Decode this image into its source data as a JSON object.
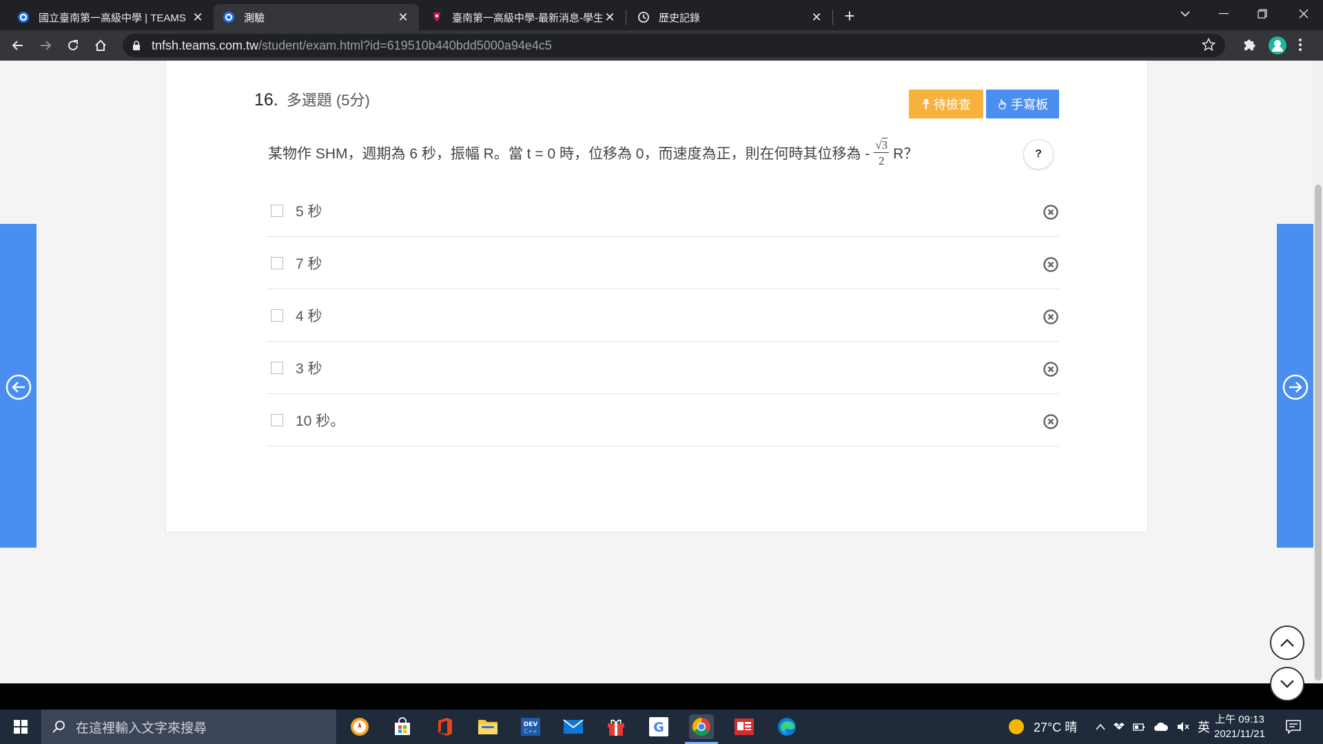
{
  "browser": {
    "tabs": [
      {
        "title": "國立臺南第一高級中學 | TEAMS",
        "active": false
      },
      {
        "title": "測驗",
        "active": true
      },
      {
        "title": "臺南第一高級中學-最新消息-學生",
        "active": false
      },
      {
        "title": "歷史記錄",
        "active": false
      }
    ],
    "url_host": "tnfsh.teams.com.tw",
    "url_path": "/student/exam.html?id=619510b440bdd5000a94e4c5"
  },
  "question": {
    "number": "16.",
    "type_label": "多選題 (5分)",
    "pending_button": "待檢查",
    "handwriting_button": "手寫板",
    "help_label": "?",
    "text_before": "某物作 SHM，週期為 6 秒，振幅 R。當 t = 0 時，位移為 0，而速度為正，則在何時其位移為 -",
    "frac_num": "3",
    "frac_den": "2",
    "text_after": "R？",
    "options": [
      {
        "label": "5 秒"
      },
      {
        "label": "7 秒"
      },
      {
        "label": "4 秒"
      },
      {
        "label": "3 秒"
      },
      {
        "label": "10 秒。"
      }
    ]
  },
  "taskbar": {
    "search_placeholder": "在這裡輸入文字來搜尋",
    "weather": "27°C 晴",
    "ime": "英",
    "time": "上午 09:13",
    "date": "2021/11/21"
  },
  "colors": {
    "accent_blue": "#4a8ff0",
    "pending_orange": "#f7b13d"
  }
}
